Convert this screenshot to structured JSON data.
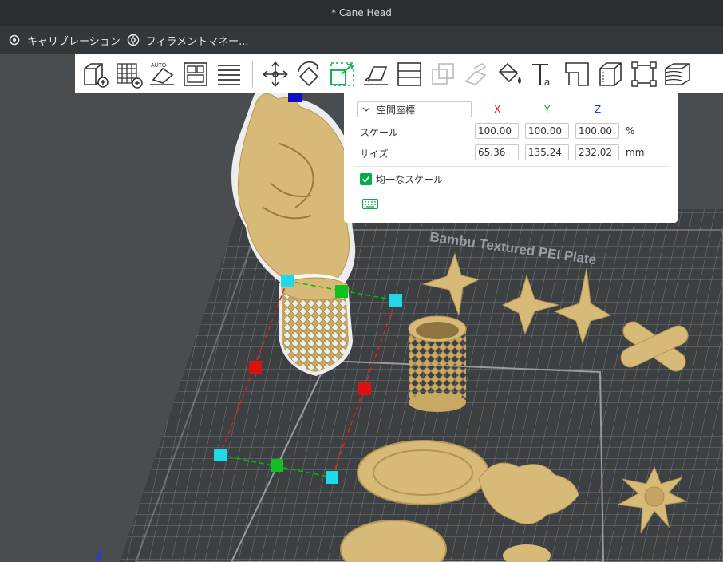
{
  "window": {
    "title": "* Cane Head"
  },
  "menubar": {
    "items": [
      {
        "label": "キャリブレーション",
        "icon": "calibration-icon"
      },
      {
        "label": "フィラメントマネー...",
        "icon": "filament-icon"
      }
    ]
  },
  "toolbar": {
    "buttons": [
      "add-object-icon",
      "add-plate-icon",
      "auto-orient-icon",
      "arrange-icon",
      "split-layers-icon",
      "move-icon",
      "rotate-icon",
      "scale-icon",
      "lay-on-face-icon",
      "cut-icon",
      "boolean-icon",
      "support-paint-icon",
      "color-paint-icon",
      "text-icon",
      "seam-icon",
      "measure-icon",
      "assembly-icon",
      "variable-layer-icon"
    ]
  },
  "scale_panel": {
    "coordinate_system": "空間座標",
    "axis_labels": [
      "X",
      "Y",
      "Z"
    ],
    "axis_colors": [
      "#e02020",
      "#00ae42",
      "#2040e0"
    ],
    "scale": {
      "label": "スケール",
      "x": "100.00",
      "y": "100.00",
      "z": "100.00",
      "unit": "%"
    },
    "size": {
      "label": "サイズ",
      "x": "65.36",
      "y": "135.24",
      "z": "232.02",
      "unit": "mm"
    },
    "uniform_scale": {
      "label": "均一なスケール",
      "checked": true
    }
  },
  "scene": {
    "plate_label": "Bambu Textured PEI Plate",
    "accent_color": "#00ae42",
    "model_color": "#d7b978"
  }
}
